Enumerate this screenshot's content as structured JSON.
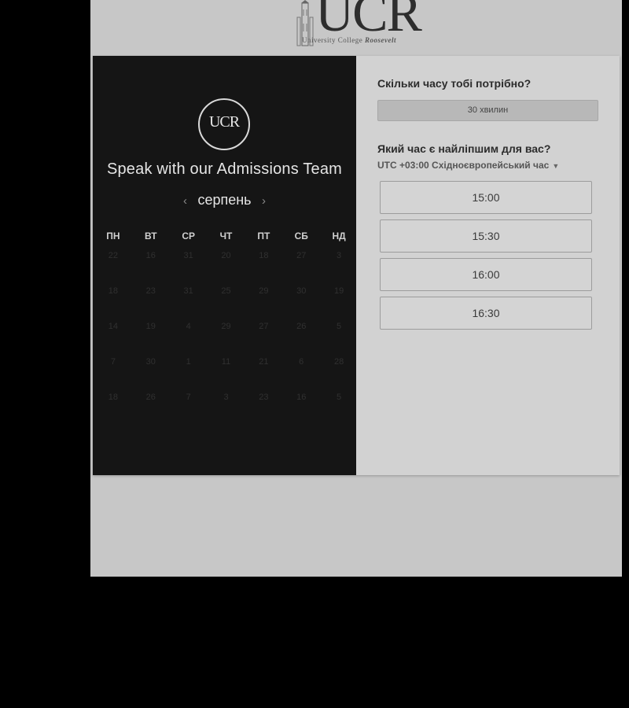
{
  "logo": {
    "letters": "UCR",
    "subtitle_plain": "University College ",
    "subtitle_italic": "Roosevelt"
  },
  "left_panel": {
    "badge_text": "UCR",
    "title": "Speak with our Admissions Team",
    "month": "серпень",
    "prev_arrow": "‹",
    "next_arrow": "›",
    "weekdays": [
      "ПН",
      "ВТ",
      "СР",
      "ЧТ",
      "ПТ",
      "СБ",
      "НД"
    ],
    "weeks": [
      [
        "22",
        "16",
        "31",
        "20",
        "18",
        "27",
        "3"
      ],
      [
        "18",
        "23",
        "31",
        "25",
        "29",
        "30",
        "19"
      ],
      [
        "14",
        "19",
        "4",
        "29",
        "27",
        "26",
        "5"
      ],
      [
        "7",
        "30",
        "1",
        "11",
        "21",
        "6",
        "28"
      ],
      [
        "18",
        "26",
        "7",
        "3",
        "23",
        "16",
        "5"
      ]
    ]
  },
  "right_panel": {
    "duration_question": "Скільки часу тобі потрібно?",
    "duration_value": "30 хвилин",
    "time_question": "Який час є найліпшим для вас?",
    "timezone": "UTC +03:00 Східноєвропейський час",
    "time_slots": [
      "15:00",
      "15:30",
      "16:00",
      "16:30"
    ]
  },
  "colors": {
    "left_panel_bg": "#151515",
    "right_panel_bg": "#d2d2d2",
    "page_bg": "#c7c7c7",
    "outer_bg": "#000000"
  }
}
